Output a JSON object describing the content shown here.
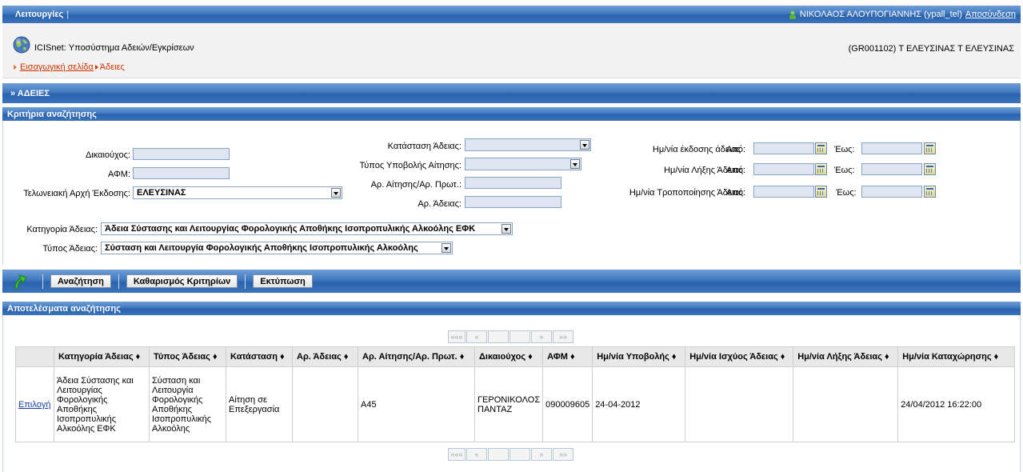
{
  "topbar": {
    "menu_label": "Λειτουργίες",
    "menu_sep": "|",
    "user_text": "ΝΙΚΟΛΑΟΣ ΑΛΟΥΠΟΓΙΑΝΝΗΣ (ypall_tel)",
    "logout_label": "Αποσύνδεση"
  },
  "header": {
    "app_name": "ICISnet: Υποσύστημα Αδειών/Εγκρίσεων",
    "station": "(GR001102) Τ ΕΛΕΥΣΙΝΑΣ Τ ΕΛΕΥΣΙΝΑΣ",
    "breadcrumb_home": "Εισαγωγική σελίδα",
    "breadcrumb_current": "Άδειες"
  },
  "section_title": "» ΑΔΕΙΕΣ",
  "criteria": {
    "title": "Κριτήρια αναζήτησης",
    "beneficiary_label": "Δικαιούχος:",
    "beneficiary_value": "",
    "afm_label": "ΑΦΜ:",
    "afm_value": "",
    "customs_label": "Τελωνειακή Αρχή Έκδοσης:",
    "customs_value": "ΕΛΕΥΣΙΝΑΣ",
    "status_label": "Κατάσταση Άδειας:",
    "status_value": "",
    "submission_type_label": "Τύπος Υποβολής Αίτησης:",
    "submission_type_value": "",
    "app_no_label": "Αρ. Αίτησης/Αρ. Πρωτ.:",
    "app_no_value": "",
    "permit_no_label": "Αρ. Άδειας:",
    "permit_no_value": "",
    "issue_date_label": "Ημ/νία έκδοσης άδειας :",
    "expiry_date_label": "Ημ/νία Λήξης Άδειας:",
    "amend_date_label": "Ημ/νία Τροποποίησης Άδειας:",
    "from_label": "Από:",
    "to_label": "Έως:",
    "category_label": "Κατηγορία Άδειας:",
    "category_value": "Άδεια Σύστασης και Λειτουργίας Φορολογικής Αποθήκης Ισοπροπυλικής Αλκοόλης ΕΦΚ",
    "type_label": "Τύπος Άδειας:",
    "type_value": "Σύσταση και Λειτουργία Φορολογικής Αποθήκης Ισοπροπυλικής Αλκοόλης"
  },
  "toolbar": {
    "search_label": "Αναζήτηση",
    "clear_label": "Καθαρισμός Κριτηρίων",
    "print_label": "Εκτύπωση"
  },
  "results": {
    "title": "Αποτελέσματα αναζήτησης",
    "pager": {
      "first": "«««",
      "prev": "«",
      "next": "»",
      "last": "»»"
    },
    "columns": [
      "",
      "Κατηγορία Άδειας ♦",
      "Τύπος Άδειας ♦",
      "Κατάσταση ♦",
      "Αρ. Άδειας ♦",
      "Αρ. Αίτησης/Αρ. Πρωτ. ♦",
      "Δικαιούχος ♦",
      "ΑΦΜ ♦",
      "Ημ/νία Υποβολής ♦",
      "Ημ/νία Ισχύος Άδειας ♦",
      "Ημ/νία Λήξης Άδειας ♦",
      "Ημ/νία Καταχώρησης ♦"
    ],
    "rows": [
      {
        "select": "Επιλογή",
        "category": "Άδεια Σύστασης και Λειτουργίας Φορολογικής Αποθήκης Ισοπροπυλικής Αλκοόλης ΕΦΚ",
        "type": "Σύσταση και Λειτουργία Φορολογικής Αποθήκης Ισοπροπυλικής Αλκοόλης",
        "status": "Αίτηση σε Επεξεργασία",
        "permit_no": "",
        "app_no": "A45",
        "beneficiary": "ΓΕΡΟΝΙΚΟΛΟΣ ΠΑΝΤΑΖ",
        "afm": "090009605",
        "submission_date": "24-04-2012",
        "validity_date": "",
        "expiry_date": "",
        "registration_date": "24/04/2012 16:22:00"
      }
    ]
  },
  "colors": {
    "bar_blue": "#3f78c0",
    "link_orange": "#cc3300",
    "link_blue": "#1a3fa8"
  }
}
